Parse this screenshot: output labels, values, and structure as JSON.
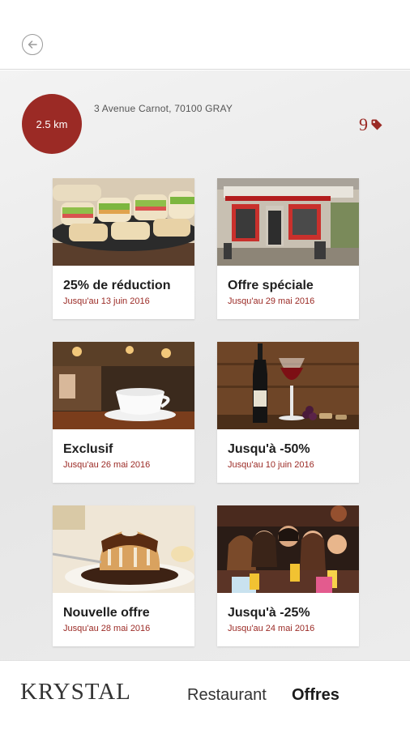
{
  "header": {
    "back_icon": "arrow-left-circle-icon"
  },
  "restaurant": {
    "distance": "2.5 km",
    "address": "3 Avenue Carnot, 70100 GRAY",
    "offer_count": "9",
    "offer_icon": "price-tag-icon"
  },
  "offers": [
    {
      "title": "25% de réduction",
      "date": "Jusqu'au 13 juin 2016",
      "image": "sandwiches-photo"
    },
    {
      "title": "Offre spéciale",
      "date": "Jusqu'au 29 mai 2016",
      "image": "restaurant-facade-photo"
    },
    {
      "title": "Exclusif",
      "date": "Jusqu'au 26 mai 2016",
      "image": "coffee-cup-photo"
    },
    {
      "title": "Jusqu'à -50%",
      "date": "Jusqu'au 10 juin 2016",
      "image": "wine-bottle-photo"
    },
    {
      "title": "Nouvelle offre",
      "date": "Jusqu'au 28 mai 2016",
      "image": "dessert-photo"
    },
    {
      "title": "Jusqu'à -25%",
      "date": "Jusqu'au 24 mai 2016",
      "image": "friends-bar-photo"
    }
  ],
  "footer": {
    "logo": "KRYSTAL",
    "tabs": [
      {
        "label": "Restaurant",
        "active": false
      },
      {
        "label": "Offres",
        "active": true
      }
    ]
  },
  "colors": {
    "accent": "#9b2a25",
    "background": "#ececec"
  }
}
